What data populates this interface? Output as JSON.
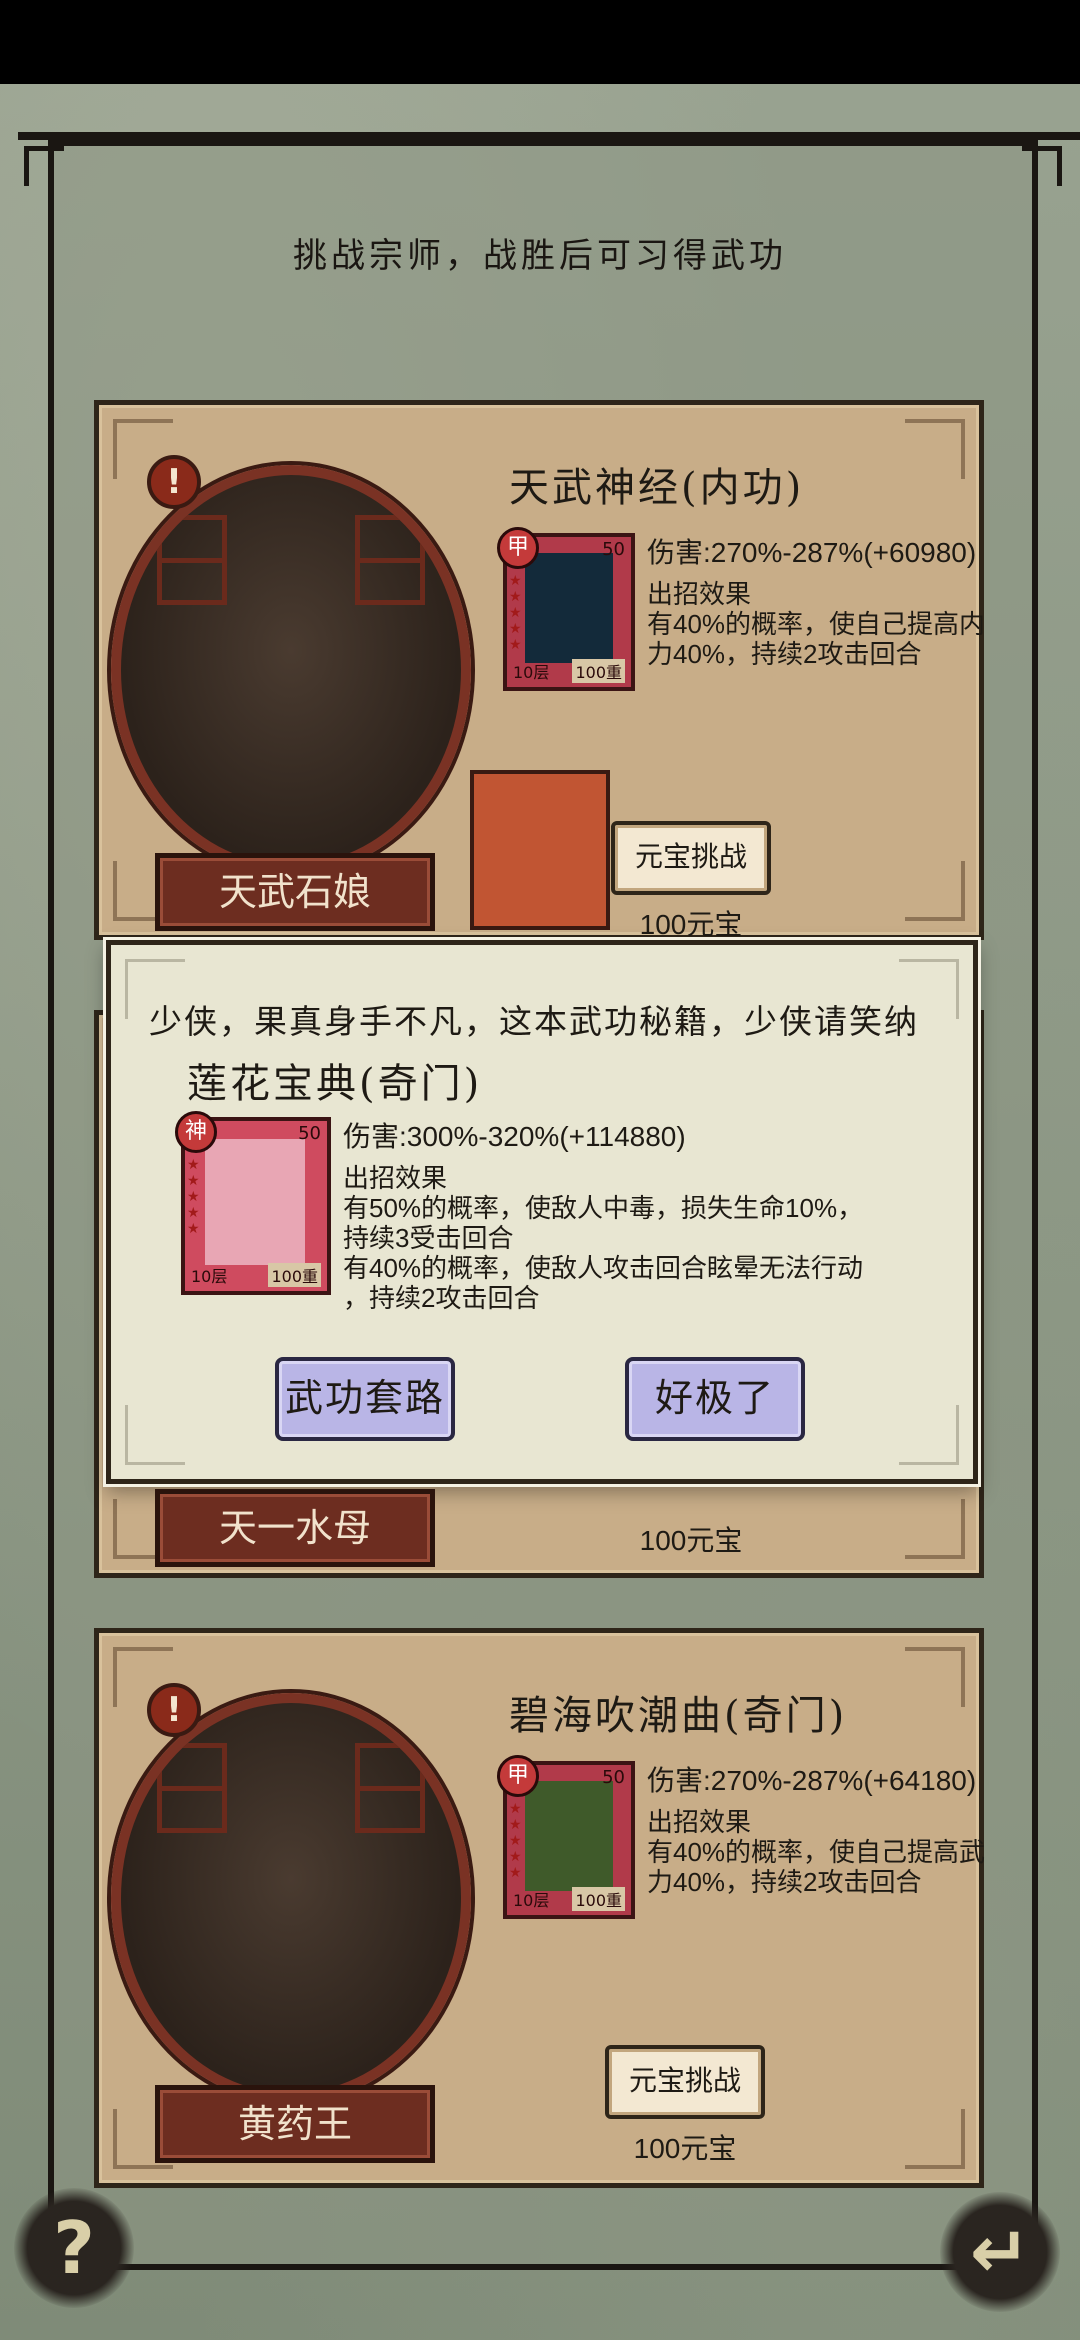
{
  "subtitle": "挑战宗师，战胜后可习得武功",
  "cards": [
    {
      "name": "天武石娘",
      "skill_title": "天武神经(内功)",
      "grade": "甲",
      "level": "50",
      "layers": "10层",
      "weight": "100重",
      "damage": "伤害:270%-287%(+60980)",
      "effect_label": "出招效果",
      "effect_desc": "有40%的概率，使自己提高内力40%，持续2攻击回合",
      "button": "元宝挑战",
      "price": "100元宝"
    },
    {
      "name": "天一水母",
      "price": "100元宝"
    },
    {
      "name": "黄药王",
      "skill_title": "碧海吹潮曲(奇门)",
      "grade": "甲",
      "level": "50",
      "layers": "10层",
      "weight": "100重",
      "damage": "伤害:270%-287%(+64180)",
      "effect_label": "出招效果",
      "effect_desc": "有40%的概率，使自己提高武力40%，持续2攻击回合",
      "button": "元宝挑战",
      "price": "100元宝"
    }
  ],
  "dialog": {
    "message": "少侠，果真身手不凡，这本武功秘籍，少侠请笑纳",
    "skill_title": "莲花宝典(奇门)",
    "grade": "神",
    "level": "50",
    "layers": "10层",
    "weight": "100重",
    "damage": "伤害:300%-320%(+114880)",
    "effect_label": "出招效果",
    "effect_line1": "有50%的概率，使敌人中毒，损失生命10%，",
    "effect_line2": "持续3受击回合",
    "effect_line3": "有40%的概率，使敌人攻击回合眩晕无法行动",
    "effect_line4": "，持续2攻击回合",
    "btn_routine": "武功套路",
    "btn_ok": "好极了"
  },
  "corner": {
    "help": "?",
    "back_icon": "return-arrow-icon"
  }
}
